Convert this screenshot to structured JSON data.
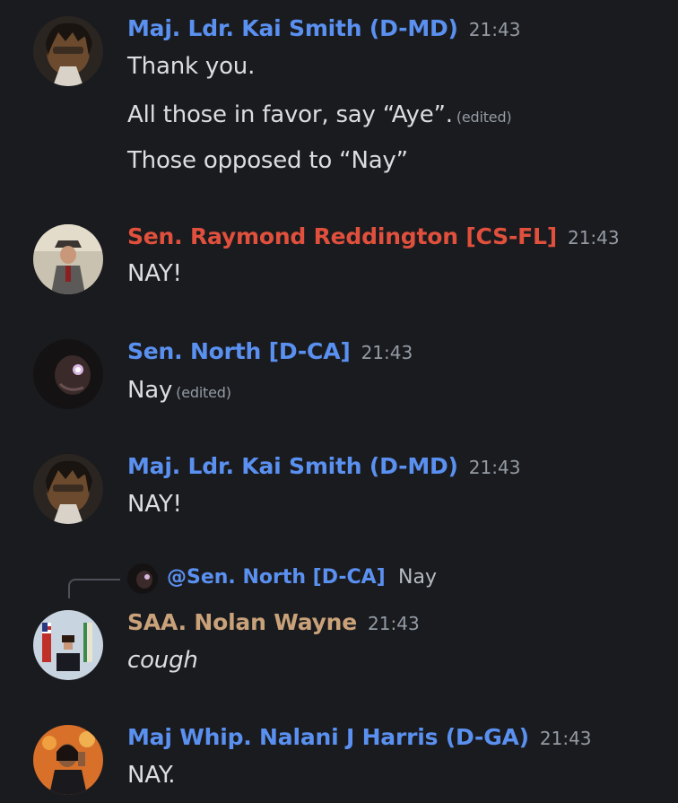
{
  "colors": {
    "background": "#1a1b1f",
    "blue_role": "#5a90f0",
    "red_role": "#e0503c",
    "gold_role": "#c9a27a",
    "text": "#dbdee1",
    "muted": "#949ba4"
  },
  "messages": [
    {
      "author": "Maj. Ldr. Kai Smith (D-MD)",
      "time": "21:43",
      "lines": [
        "Thank you.",
        "All those in favor, say “Aye”.",
        "Those opposed to “Nay”"
      ],
      "edited": "(edited)"
    },
    {
      "author": "Sen. Raymond Reddington [CS-FL]",
      "time": "21:43",
      "lines": [
        "NAY!"
      ]
    },
    {
      "author": "Sen. North [D-CA]",
      "time": "21:43",
      "lines": [
        "Nay"
      ],
      "edited": "(edited)"
    },
    {
      "author": "Maj. Ldr. Kai Smith (D-MD)",
      "time": "21:43",
      "lines": [
        "NAY!"
      ]
    },
    {
      "reply_to": {
        "mention": "@Sen. North [D-CA]",
        "text": "Nay"
      },
      "author": "SAA. Nolan Wayne",
      "time": "21:43",
      "lines": [
        "cough"
      ]
    },
    {
      "author": "Maj Whip. Nalani J Harris (D-GA)",
      "time": "21:43",
      "lines": [
        "NAY."
      ]
    }
  ]
}
